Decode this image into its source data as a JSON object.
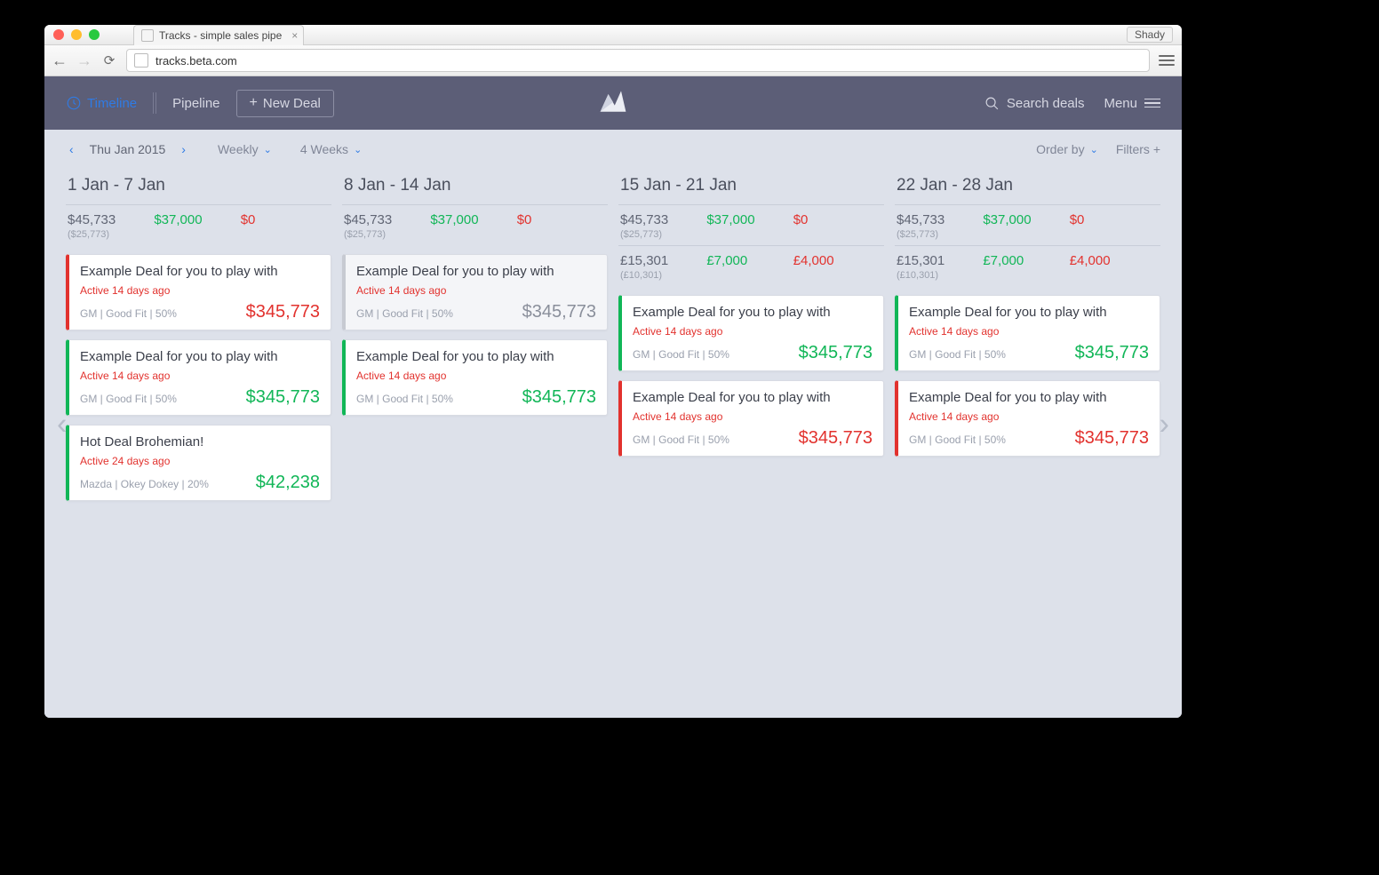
{
  "chrome": {
    "tab_title": "Tracks - simple sales pipe",
    "url": "tracks.beta.com",
    "extension": "Shady"
  },
  "header": {
    "timeline": "Timeline",
    "pipeline": "Pipeline",
    "new_deal": "New Deal",
    "search_placeholder": "Search deals",
    "menu": "Menu"
  },
  "toolbar": {
    "date": "Thu Jan 2015",
    "granularity": "Weekly",
    "span": "4 Weeks",
    "order_by": "Order by",
    "filters": "Filters +"
  },
  "columns": [
    {
      "title": "1 Jan - 7 Jan",
      "sums": [
        {
          "a": "$45,733",
          "a_sub": "($25,773)",
          "b": "$37,000",
          "c": "$0"
        }
      ],
      "cards": [
        {
          "accent": "red",
          "title": "Example Deal for you to play with",
          "active": "Active 14 days ago",
          "meta": "GM | Good Fit | 50%",
          "amount": "$345,773",
          "amt_color": "red"
        },
        {
          "accent": "green",
          "title": "Example Deal for you to play with",
          "active": "Active 14 days ago",
          "meta": "GM | Good Fit | 50%",
          "amount": "$345,773",
          "amt_color": "green"
        },
        {
          "accent": "green",
          "title": "Hot Deal Brohemian!",
          "active": "Active 24 days ago",
          "meta": "Mazda | Okey Dokey | 20%",
          "amount": "$42,238",
          "amt_color": "green"
        }
      ]
    },
    {
      "title": "8 Jan - 14 Jan",
      "sums": [
        {
          "a": "$45,733",
          "a_sub": "($25,773)",
          "b": "$37,000",
          "c": "$0"
        }
      ],
      "cards": [
        {
          "accent": "grey",
          "title": "Example Deal for you to play with",
          "active": "Active 14 days ago",
          "meta": "GM | Good Fit | 50%",
          "amount": "$345,773",
          "amt_color": "grey"
        },
        {
          "accent": "green",
          "title": "Example Deal for you to play with",
          "active": "Active 14 days ago",
          "meta": "GM | Good Fit | 50%",
          "amount": "$345,773",
          "amt_color": "green"
        }
      ]
    },
    {
      "title": "15 Jan - 21 Jan",
      "sums": [
        {
          "a": "$45,733",
          "a_sub": "($25,773)",
          "b": "$37,000",
          "c": "$0"
        },
        {
          "a": "£15,301",
          "a_sub": "(£10,301)",
          "b": "£7,000",
          "c": "£4,000"
        }
      ],
      "cards": [
        {
          "accent": "green",
          "title": "Example Deal for you to play with",
          "active": "Active 14 days ago",
          "meta": "GM | Good Fit | 50%",
          "amount": "$345,773",
          "amt_color": "green"
        },
        {
          "accent": "red",
          "title": "Example Deal for you to play with",
          "active": "Active 14 days ago",
          "meta": "GM | Good Fit | 50%",
          "amount": "$345,773",
          "amt_color": "red"
        }
      ]
    },
    {
      "title": "22 Jan - 28 Jan",
      "sums": [
        {
          "a": "$45,733",
          "a_sub": "($25,773)",
          "b": "$37,000",
          "c": "$0"
        },
        {
          "a": "£15,301",
          "a_sub": "(£10,301)",
          "b": "£7,000",
          "c": "£4,000"
        }
      ],
      "cards": [
        {
          "accent": "green",
          "title": "Example Deal for you to play with",
          "active": "Active 14 days ago",
          "meta": "GM | Good Fit | 50%",
          "amount": "$345,773",
          "amt_color": "green"
        },
        {
          "accent": "red",
          "title": "Example Deal for you to play with",
          "active": "Active 14 days ago",
          "meta": "GM | Good Fit | 50%",
          "amount": "$345,773",
          "amt_color": "red"
        }
      ]
    }
  ]
}
